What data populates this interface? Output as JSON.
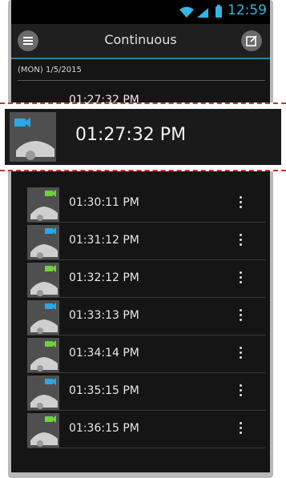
{
  "status": {
    "time": "12:59"
  },
  "appbar": {
    "title": "Continuous"
  },
  "date_header": "(MON) 1/5/2015",
  "highlight": {
    "time": "01:27:32 PM",
    "camera": "blue"
  },
  "hidden_row_time": "01:27:32 PM",
  "recordings": [
    {
      "time": "01:30:11 PM",
      "camera": "green"
    },
    {
      "time": "01:31:12 PM",
      "camera": "blue"
    },
    {
      "time": "01:32:12 PM",
      "camera": "green"
    },
    {
      "time": "01:33:13 PM",
      "camera": "blue"
    },
    {
      "time": "01:34:14 PM",
      "camera": "green"
    },
    {
      "time": "01:35:15 PM",
      "camera": "blue"
    },
    {
      "time": "01:36:15 PM",
      "camera": "green"
    }
  ],
  "colors": {
    "accent": "#33b5e5",
    "camera_blue": "#29a9e8",
    "camera_green": "#6fd23a",
    "highlight_border": "#c0392b"
  }
}
